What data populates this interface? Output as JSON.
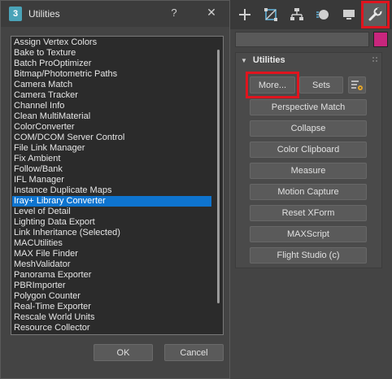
{
  "dialog": {
    "icon_text": "3",
    "title": "Utilities",
    "help_label": "?",
    "close_label": "✕",
    "list_items": [
      "Assign Vertex Colors",
      "Bake to Texture",
      "Batch ProOptimizer",
      "Bitmap/Photometric Paths",
      "Camera Match",
      "Camera Tracker",
      "Channel Info",
      "Clean MultiMaterial",
      "ColorConverter",
      "COM/DCOM Server Control",
      "File Link Manager",
      "Fix Ambient",
      "Follow/Bank",
      "IFL Manager",
      "Instance Duplicate Maps",
      "Iray+ Library Converter",
      "Level of Detail",
      "Lighting Data Export",
      "Link Inheritance (Selected)",
      "MACUtilities",
      "MAX File Finder",
      "MeshValidator",
      "Panorama Exporter",
      "PBRImporter",
      "Polygon Counter",
      "Real-Time Exporter",
      "Rescale World Units",
      "Resource Collector"
    ],
    "selected_item": "Iray+ Library Converter",
    "ok_label": "OK",
    "cancel_label": "Cancel"
  },
  "command_panel": {
    "tabs": [
      "create-icon",
      "modify-icon",
      "hierarchy-icon",
      "motion-icon",
      "display-icon",
      "utilities-icon"
    ],
    "active_tab": "utilities-icon",
    "swatch_color": "#c8267d",
    "rollout_title": "Utilities",
    "more_label": "More...",
    "sets_label": "Sets",
    "utility_buttons": [
      "Perspective Match",
      "Collapse",
      "Color Clipboard",
      "Measure",
      "Motion Capture",
      "Reset XForm",
      "MAXScript",
      "Flight Studio (c)"
    ]
  },
  "colors": {
    "highlight": "#e0141e",
    "selection": "#0e74cf"
  }
}
